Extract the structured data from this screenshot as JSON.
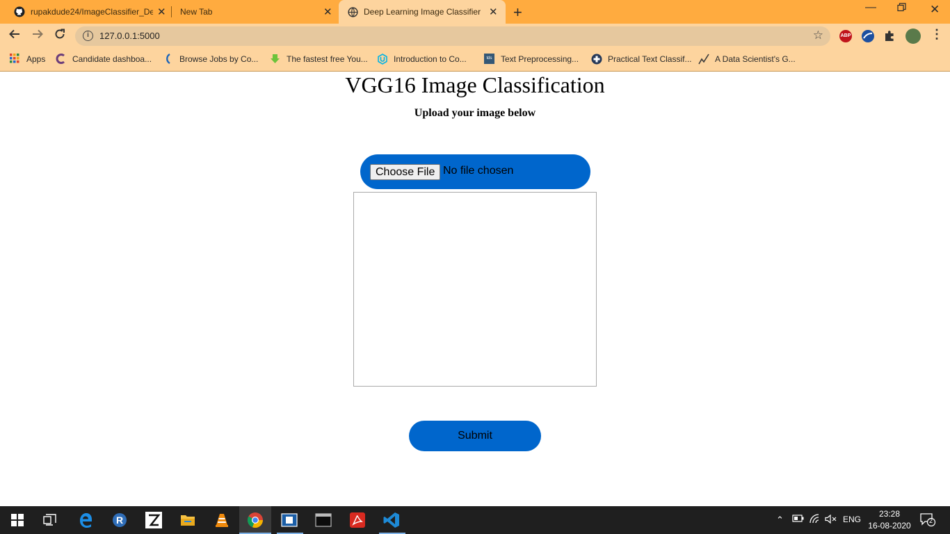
{
  "browser": {
    "tabs": [
      {
        "title": "rupakdude24/ImageClassifier_De",
        "icon": "github-icon"
      },
      {
        "title": "New Tab",
        "icon": ""
      },
      {
        "title": "Deep Learning Image Classifier",
        "icon": "globe-icon"
      }
    ],
    "url": "127.0.0.1:5000",
    "bookmarks": [
      {
        "label": "Apps",
        "icon": "apps-grid-icon"
      },
      {
        "label": "Candidate dashboa...",
        "icon": "candidate-icon"
      },
      {
        "label": "Browse Jobs by Co...",
        "icon": "jobs-icon"
      },
      {
        "label": "The fastest free You...",
        "icon": "download-arrow-icon"
      },
      {
        "label": "Introduction to Co...",
        "icon": "udacity-icon"
      },
      {
        "label": "Text Preprocessing...",
        "icon": "tds-icon"
      },
      {
        "label": "Practical Text Classif...",
        "icon": "medical-cross-icon"
      },
      {
        "label": "A Data Scientist's G...",
        "icon": "chart-line-icon"
      }
    ],
    "extensions": {
      "abp": "ABP"
    }
  },
  "page": {
    "title": "VGG16 Image Classification",
    "subtitle": "Upload your image below",
    "file_input": {
      "button_label": "Choose File",
      "status": "No file chosen"
    },
    "submit_label": "Submit"
  },
  "taskbar": {
    "tray": {
      "language": "ENG",
      "notification_count": "2"
    },
    "clock": {
      "time": "23:28",
      "date": "16-08-2020"
    }
  },
  "colors": {
    "accent": "#0066cc",
    "tabstrip": "#ffab3f",
    "toolbar": "#fdd49e"
  }
}
